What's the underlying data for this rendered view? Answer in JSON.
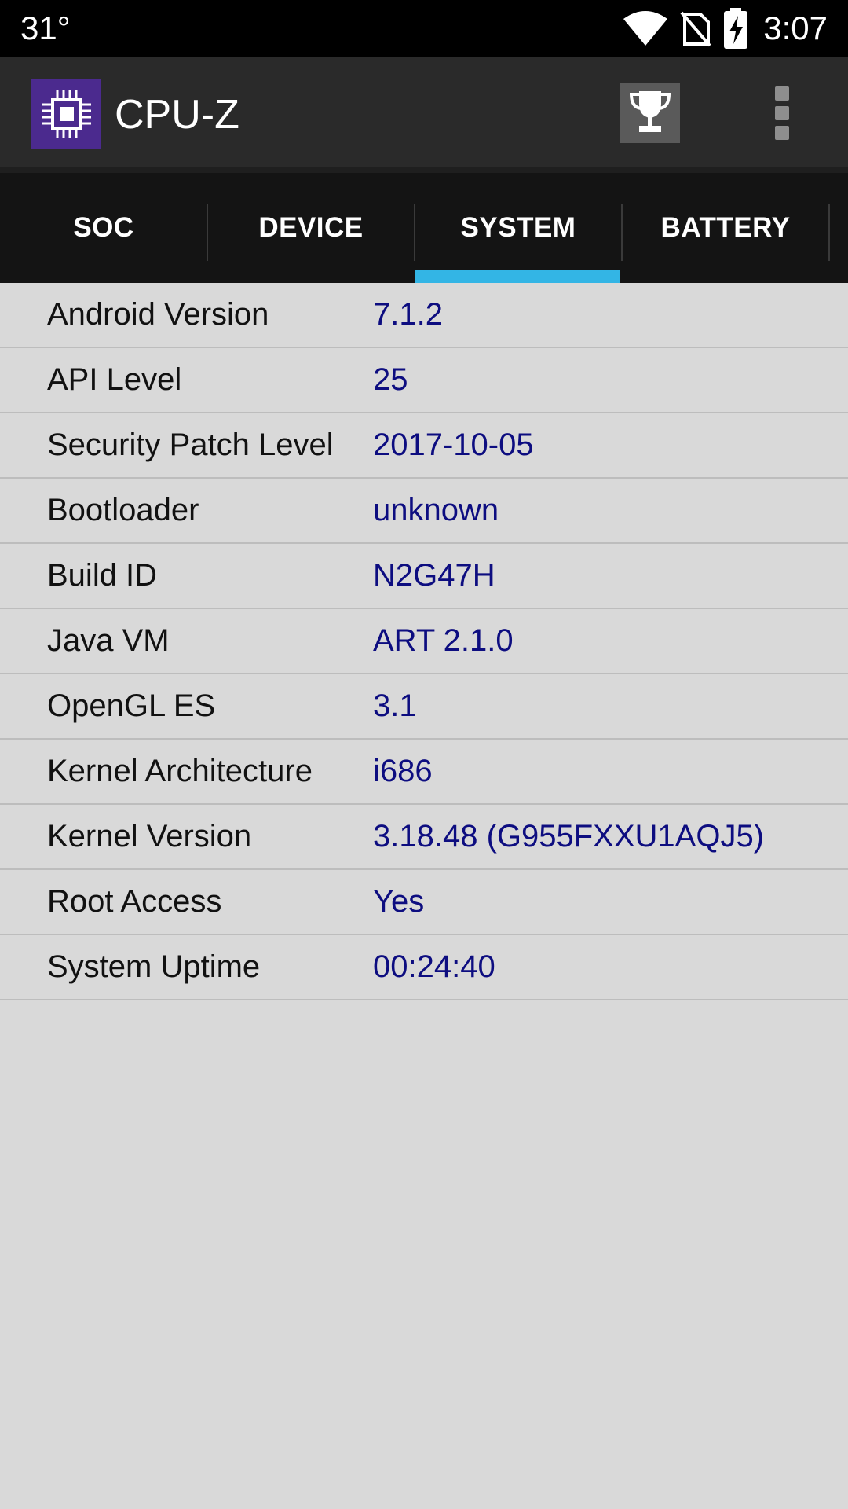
{
  "status_bar": {
    "temperature": "31°",
    "time": "3:07",
    "icons": [
      "wifi-icon",
      "no-sim-icon",
      "battery-charging-icon"
    ]
  },
  "app_bar": {
    "title": "CPU-Z",
    "logo_icon": "cpu-chip-icon",
    "actions": [
      "trophy-icon",
      "overflow-menu-icon"
    ]
  },
  "tabs": [
    {
      "label": "SOC"
    },
    {
      "label": "DEVICE"
    },
    {
      "label": "SYSTEM",
      "selected": true
    },
    {
      "label": "BATTERY"
    }
  ],
  "system_info": [
    {
      "label": "Android Version",
      "value": "7.1.2"
    },
    {
      "label": "API Level",
      "value": "25"
    },
    {
      "label": "Security Patch Level",
      "value": "2017-10-05"
    },
    {
      "label": "Bootloader",
      "value": "unknown"
    },
    {
      "label": "Build ID",
      "value": "N2G47H"
    },
    {
      "label": "Java VM",
      "value": "ART 2.1.0"
    },
    {
      "label": "OpenGL ES",
      "value": "3.1"
    },
    {
      "label": "Kernel Architecture",
      "value": "i686"
    },
    {
      "label": "Kernel Version",
      "value": "3.18.48 (G955FXXU1AQJ5)"
    },
    {
      "label": "Root Access",
      "value": "Yes"
    },
    {
      "label": "System Uptime",
      "value": "00:24:40"
    }
  ],
  "colors": {
    "accent": "#33b5e5",
    "value_text": "#0d0d80",
    "app_bar": "#2a2a2a",
    "tab_bar": "#141414",
    "content_background": "#d9d9d9",
    "logo_background": "#4b2a8e"
  }
}
